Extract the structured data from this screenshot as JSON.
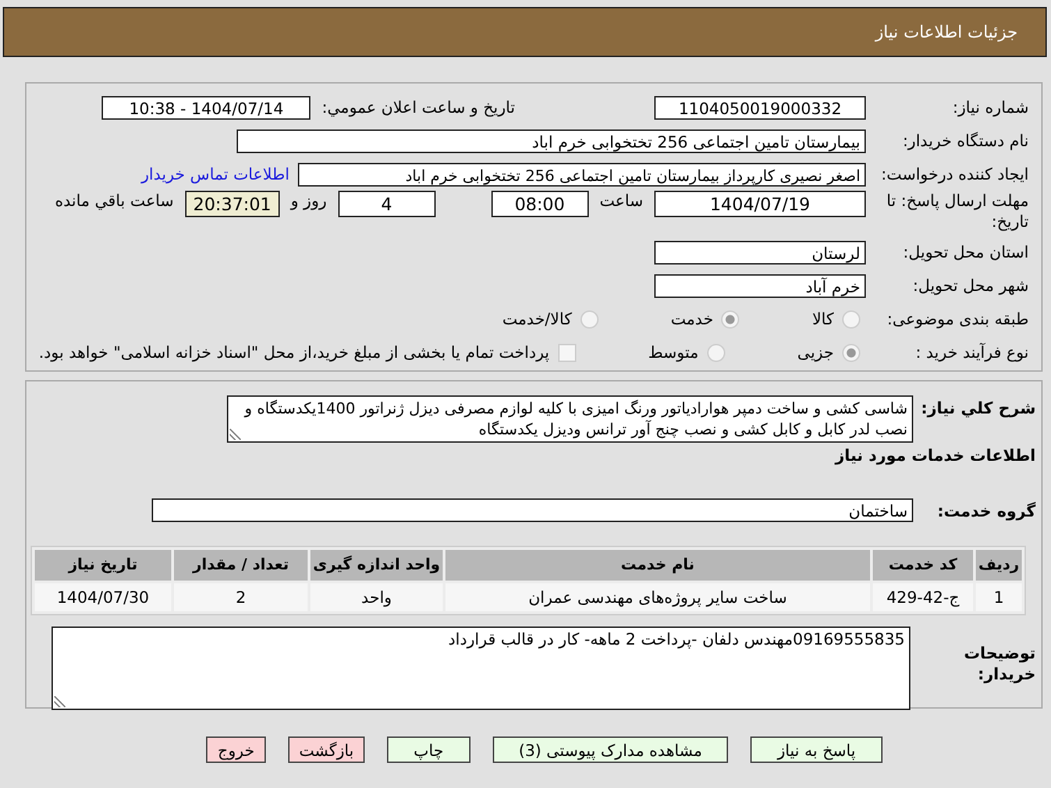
{
  "header": {
    "title": "جزئیات اطلاعات نیاز"
  },
  "need_number": {
    "label": "شماره نیاز:",
    "value": "1104050019000332"
  },
  "announce": {
    "label": "تاریخ و ساعت اعلان عمومي:",
    "value": "1404/07/14 - 10:38"
  },
  "buyer_org": {
    "label": "نام دستگاه خریدار:",
    "value": "بیمارستان تامین اجتماعی  256 تختخوابی خرم اباد"
  },
  "requester": {
    "label": "ایجاد کننده درخواست:",
    "value": "اصغر نصیری کارپرداز بیمارستان تامین اجتماعی  256 تختخوابی خرم اباد",
    "link": "اطلاعات تماس خریدار"
  },
  "deadline": {
    "label": "مهلت ارسال پاسخ: تا تاریخ:",
    "date": "1404/07/19",
    "time_label": "ساعت",
    "time": "08:00",
    "days": "4",
    "days_label": "روز و",
    "remaining": "20:37:01",
    "remaining_label": "ساعت باقي مانده"
  },
  "province": {
    "label": "استان محل تحویل:",
    "value": "لرستان"
  },
  "city": {
    "label": "شهر محل تحویل:",
    "value": "خرم آباد"
  },
  "category": {
    "label": "طبقه بندی موضوعی:",
    "options": [
      {
        "label": "کالا",
        "selected": false
      },
      {
        "label": "خدمت",
        "selected": true
      },
      {
        "label": "کالا/خدمت",
        "selected": false
      }
    ]
  },
  "process": {
    "label": "نوع فرآیند خرید :",
    "options": [
      {
        "label": "جزیی",
        "selected": true
      },
      {
        "label": "متوسط",
        "selected": false
      }
    ],
    "treasury": {
      "label": "پرداخت تمام یا بخشی از مبلغ خرید،از محل \"اسناد خزانه اسلامی\" خواهد بود.",
      "checked": false
    }
  },
  "description": {
    "label": "شرح کلي نیاز:",
    "value": "شاسی کشی و ساخت دمپر هوارادیاتور ورنگ امیزی با کلیه لوازم مصرفی دیزل ژنراتور 1400یکدستگاه و نصب لدر کابل و کابل کشی و نصب چنج آور ترانس ودیزل یکدستگاه"
  },
  "services_heading": "اطلاعات خدمات مورد نیاز",
  "service_group": {
    "label": "گروه خدمت:",
    "value": "ساختمان"
  },
  "table": {
    "columns": [
      "ردیف",
      "کد خدمت",
      "نام خدمت",
      "واحد اندازه گیری",
      "تعداد / مقدار",
      "تاریخ نیاز"
    ],
    "rows": [
      [
        "1",
        "ج-42-429",
        "ساخت سایر پروژه‌های مهندسی عمران",
        "واحد",
        "2",
        "1404/07/30"
      ]
    ]
  },
  "buyer_notes": {
    "label": "توضیحات خریدار:",
    "value": "09169555835مهندس دلفان -پرداخت 2 ماهه- کار در قالب قرارداد"
  },
  "buttons": [
    {
      "label": "پاسخ به نیاز",
      "kind": "action"
    },
    {
      "label": "مشاهده مدارک پیوستی (3)",
      "kind": "action"
    },
    {
      "label": "چاپ",
      "kind": "action"
    },
    {
      "label": "بازگشت",
      "kind": "exit"
    },
    {
      "label": "خروج",
      "kind": "exit"
    }
  ]
}
